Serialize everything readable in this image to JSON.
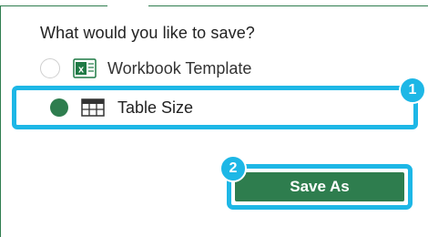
{
  "prompt": "What would you like to save?",
  "options": [
    {
      "label": "Workbook Template",
      "icon": "excel-workbook-icon",
      "selected": false
    },
    {
      "label": "Table Size",
      "icon": "table-grid-icon",
      "selected": true
    }
  ],
  "save_button_label": "Save As",
  "callouts": [
    "1",
    "2"
  ],
  "colors": {
    "accent": "#2e7d4e",
    "highlight": "#1db7e6"
  }
}
